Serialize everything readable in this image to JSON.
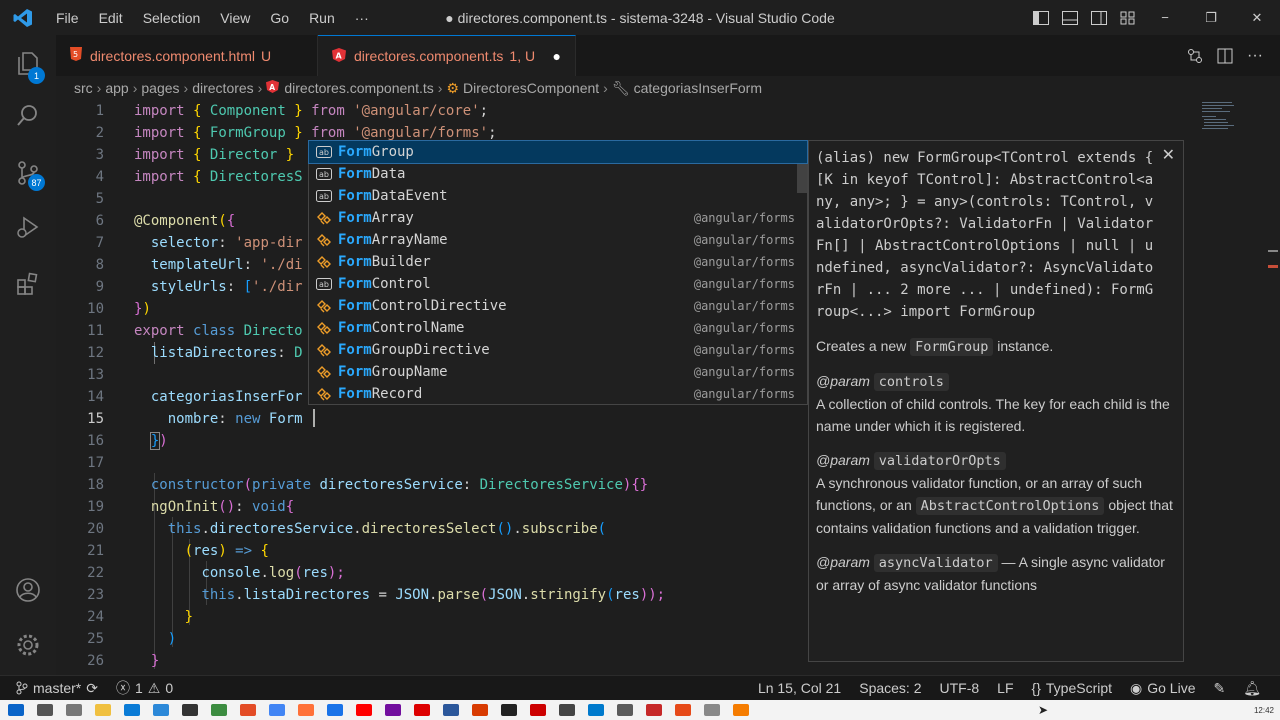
{
  "window": {
    "title": "● directores.component.ts - sistema-3248 - Visual Studio Code"
  },
  "menu": [
    "File",
    "Edit",
    "Selection",
    "View",
    "Go",
    "Run",
    "···"
  ],
  "activity": {
    "scm_badge": "87",
    "explorer_badge": "1"
  },
  "tabs": [
    {
      "label": "directores.component.html",
      "modified": "U",
      "active": false
    },
    {
      "label": "directores.component.ts",
      "modified": "1, U",
      "active": true
    }
  ],
  "breadcrumb": [
    "src",
    "app",
    "pages",
    "directores",
    "directores.component.ts",
    "DirectoresComponent",
    "categoriasInserForm"
  ],
  "editor": {
    "current_line": 15,
    "lines": [
      {
        "n": "1"
      },
      {
        "n": "2"
      },
      {
        "n": "3"
      },
      {
        "n": "4"
      },
      {
        "n": "5"
      },
      {
        "n": "6"
      },
      {
        "n": "7"
      },
      {
        "n": "8"
      },
      {
        "n": "9"
      },
      {
        "n": "10"
      },
      {
        "n": "11"
      },
      {
        "n": "12"
      },
      {
        "n": "13"
      },
      {
        "n": "14"
      },
      {
        "n": "15"
      },
      {
        "n": "16"
      },
      {
        "n": "17"
      },
      {
        "n": "18"
      },
      {
        "n": "19"
      },
      {
        "n": "20"
      },
      {
        "n": "21"
      },
      {
        "n": "22"
      },
      {
        "n": "23"
      },
      {
        "n": "24"
      },
      {
        "n": "25"
      },
      {
        "n": "26"
      }
    ],
    "code": {
      "l1": [
        "import",
        "{",
        "Component",
        "}",
        "from",
        "'@angular/core'",
        ";"
      ],
      "l2": [
        "import",
        "{",
        "FormGroup",
        "}",
        "from",
        "'@angular/forms'",
        ";"
      ],
      "l3": [
        "import",
        "{",
        "Director",
        "}"
      ],
      "l4": [
        "import",
        "{",
        "DirectoresS"
      ],
      "l6": [
        "@Component",
        "(",
        "{"
      ],
      "l7": [
        "selector",
        ": ",
        "'app-dir"
      ],
      "l8": [
        "templateUrl",
        ": ",
        "'./di"
      ],
      "l9": [
        "styleUrls",
        ": ",
        "[",
        "'./dir"
      ],
      "l10": [
        "}",
        ")"
      ],
      "l11": [
        "export",
        "class",
        "Directo"
      ],
      "l12": [
        "listaDirectores",
        ": ",
        "D"
      ],
      "l14": [
        "categoriasInserFor"
      ],
      "l15": [
        "nombre",
        ": ",
        "new",
        "Form"
      ],
      "l16": [
        "}",
        ")"
      ],
      "l18": [
        "constructor",
        "(",
        "private",
        "directoresService",
        ": ",
        "DirectoresService",
        ")",
        "{}"
      ],
      "l19": [
        "ngOnInit",
        "()",
        ": ",
        "void",
        "{"
      ],
      "l20": [
        "this",
        ".",
        "directoresService",
        ".",
        "directoresSelect",
        "()",
        ".",
        "subscribe",
        "("
      ],
      "l21": [
        "(",
        "res",
        ")",
        " => ",
        "{"
      ],
      "l22": [
        "console",
        ".",
        "log",
        "(",
        "res",
        ");"
      ],
      "l23": [
        "this",
        ".",
        "listaDirectores",
        " = ",
        "JSON",
        ".",
        "parse",
        "(",
        "JSON",
        ".",
        "stringify",
        "(",
        "res",
        "));"
      ],
      "l24": [
        "}"
      ],
      "l25": [
        ")"
      ],
      "l26": [
        "}"
      ]
    }
  },
  "suggest": {
    "match": "Form",
    "items": [
      {
        "rest": "Group",
        "source": "",
        "kind": "alias"
      },
      {
        "rest": "Data",
        "source": "",
        "kind": "alias"
      },
      {
        "rest": "DataEvent",
        "source": "",
        "kind": "alias"
      },
      {
        "rest": "Array",
        "source": "@angular/forms",
        "kind": "class"
      },
      {
        "rest": "ArrayName",
        "source": "@angular/forms",
        "kind": "class"
      },
      {
        "rest": "Builder",
        "source": "@angular/forms",
        "kind": "class"
      },
      {
        "rest": "Control",
        "source": "@angular/forms",
        "kind": "alias"
      },
      {
        "rest": "ControlDirective",
        "source": "@angular/forms",
        "kind": "class"
      },
      {
        "rest": "ControlName",
        "source": "@angular/forms",
        "kind": "class"
      },
      {
        "rest": "GroupDirective",
        "source": "@angular/forms",
        "kind": "class"
      },
      {
        "rest": "GroupName",
        "source": "@angular/forms",
        "kind": "class"
      },
      {
        "rest": "Record",
        "source": "@angular/forms",
        "kind": "class"
      }
    ]
  },
  "docs": {
    "signature": "(alias) new FormGroup<TControl extends { [K in keyof TControl]: AbstractControl<any, any>; } = any>(controls: TControl, validatorOrOpts?: ValidatorFn | ValidatorFn[] | AbstractControlOptions | null | undefined, asyncValidator?: AsyncValidatorFn | ... 2 more ... | undefined): FormGroup<...> import FormGroup",
    "creates_pre": "Creates a new",
    "creates_code": "FormGroup",
    "creates_post": "instance.",
    "param_tag": "@param",
    "p1_name": "controls",
    "p1_desc": "A collection of child controls. The key for each child is the name under which it is registered.",
    "p2_name": "validatorOrOpts",
    "p2_desc_pre": "A synchronous validator function, or an array of such functions, or an",
    "p2_code": "AbstractControlOptions",
    "p2_desc_post": "object that contains validation functions and a validation trigger.",
    "p3_name": "asyncValidator",
    "p3_desc": "— A single async validator or array of async validator functions"
  },
  "status": {
    "branch": "master*",
    "errors": "1",
    "warnings": "0",
    "position": "Ln 15, Col 21",
    "spaces": "Spaces: 2",
    "encoding": "UTF-8",
    "eol": "LF",
    "language": "TypeScript",
    "golive": "Go Live"
  },
  "taskbar": {
    "time": "12:42"
  },
  "colors": {
    "accent": "#0078d4",
    "match": "#2aaaff",
    "tab_text": "#ef8a6f"
  }
}
